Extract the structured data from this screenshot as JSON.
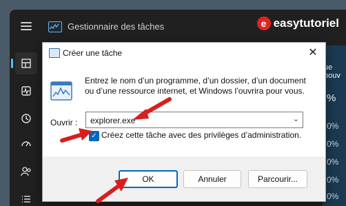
{
  "taskmanager": {
    "title": "Gestionnaire des tâches",
    "brand": "easytutoriel",
    "brand_logo_letter": "e",
    "column_header": "ue nouv",
    "percent_values": [
      "%",
      "0%",
      "0%",
      "0%",
      "0%",
      "0%",
      "0%"
    ]
  },
  "run_dialog": {
    "title": "Créer une tâche",
    "close_glyph": "✕",
    "description": "Entrez le nom d’un programme, d’un dossier, d’un document ou d’une ressource internet, et Windows l’ouvrira pour vous.",
    "open_label": "Ouvrir :",
    "open_value": "explorer.exe",
    "admin_checkbox_label": "Créez cette tâche avec des privilèges d’administration.",
    "admin_checked": true,
    "ok_label": "OK",
    "cancel_label": "Annuler",
    "browse_label": "Parcourir..."
  },
  "colors": {
    "accent": "#0067c0",
    "arrow": "#d81e1e",
    "tm_background": "#202020"
  },
  "icons": {
    "nav": [
      "processes-icon",
      "performance-icon",
      "history-icon",
      "startup-icon",
      "users-icon",
      "details-icon"
    ]
  }
}
